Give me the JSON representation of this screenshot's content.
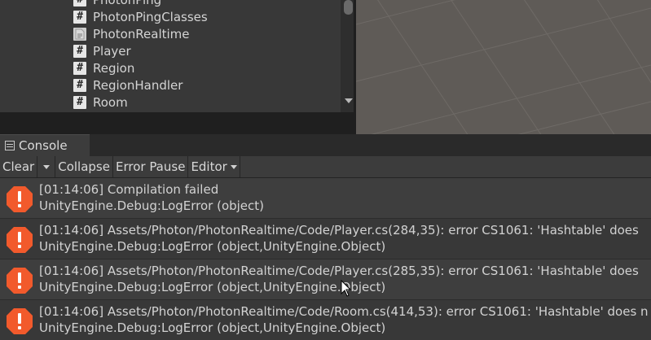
{
  "project": {
    "files": [
      {
        "name": "PhotonPing",
        "icon": "cs-script-icon"
      },
      {
        "name": "PhotonPingClasses",
        "icon": "cs-script-icon"
      },
      {
        "name": "PhotonRealtime",
        "icon": "assembly-definition-icon"
      },
      {
        "name": "Player",
        "icon": "cs-script-icon"
      },
      {
        "name": "Region",
        "icon": "cs-script-icon"
      },
      {
        "name": "RegionHandler",
        "icon": "cs-script-icon"
      },
      {
        "name": "Room",
        "icon": "cs-script-icon"
      }
    ],
    "script_icon_glyph": "#"
  },
  "console": {
    "tab_label": "Console",
    "toolbar": {
      "clear": "Clear",
      "collapse": "Collapse",
      "error_pause": "Error Pause",
      "editor": "Editor"
    },
    "entries": [
      {
        "line1": "[01:14:06] Compilation failed",
        "line2": "UnityEngine.Debug:LogError (object)"
      },
      {
        "line1": "[01:14:06] Assets/Photon/PhotonRealtime/Code/Player.cs(284,35): error CS1061: 'Hashtable' does",
        "line2": "UnityEngine.Debug:LogError (object,UnityEngine.Object)"
      },
      {
        "line1": "[01:14:06] Assets/Photon/PhotonRealtime/Code/Player.cs(285,35): error CS1061: 'Hashtable' does",
        "line2": "UnityEngine.Debug:LogError (object,UnityEngine.Object)"
      },
      {
        "line1": "[01:14:06] Assets/Photon/PhotonRealtime/Code/Room.cs(414,53): error CS1061: 'Hashtable' does n",
        "line2": "UnityEngine.Debug:LogError (object,UnityEngine.Object)"
      }
    ],
    "error_color": "#f25a2c"
  },
  "colors": {
    "panel_bg": "#383838",
    "scene_bg": "#5f5b57",
    "error": "#f25a2c"
  }
}
